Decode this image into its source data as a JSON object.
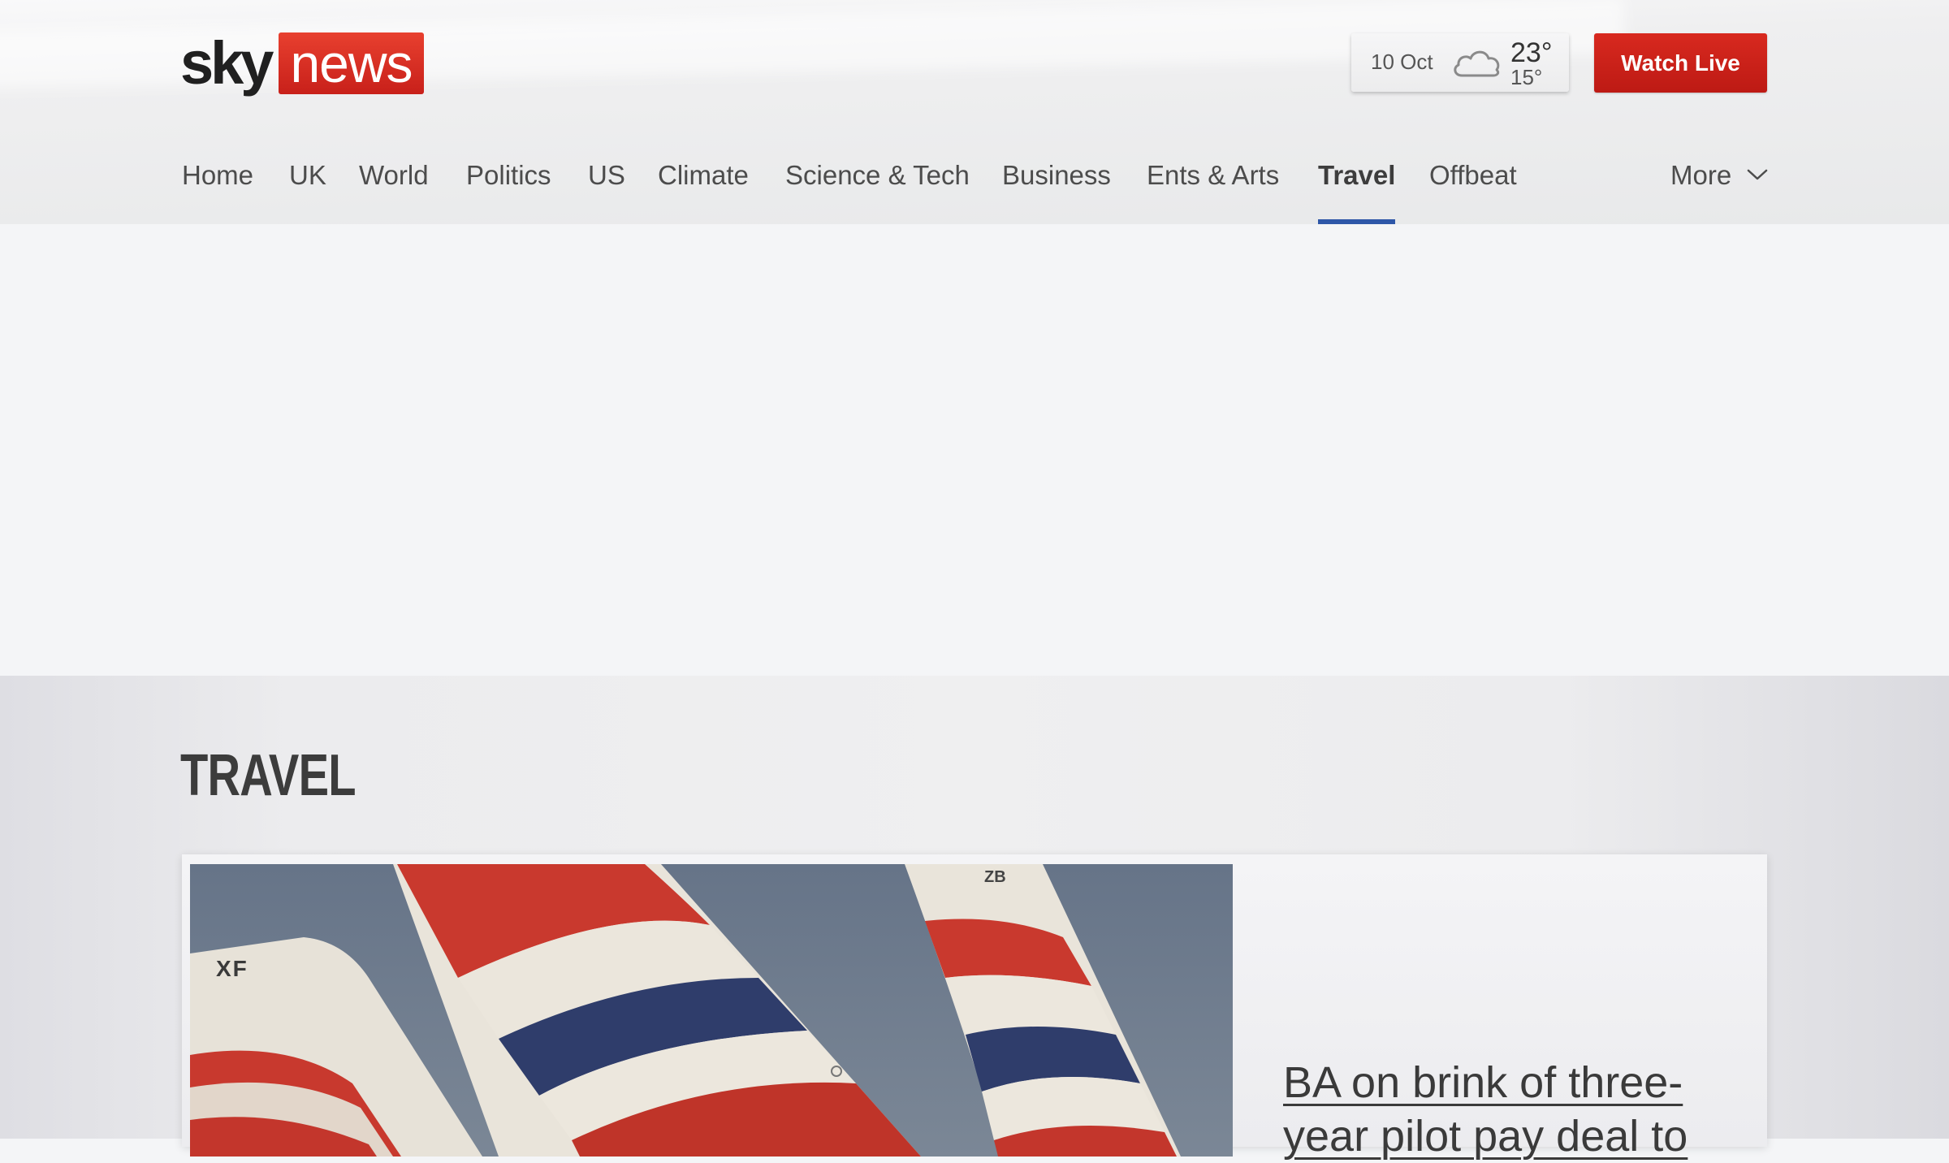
{
  "header": {
    "logo": {
      "sky": "sky",
      "news": "news"
    },
    "weather": {
      "date": "10 Oct",
      "icon": "cloud-icon",
      "high": "23°",
      "low": "15°"
    },
    "watch_live_label": "Watch Live"
  },
  "nav": {
    "items": [
      {
        "label": "Home"
      },
      {
        "label": "UK"
      },
      {
        "label": "World"
      },
      {
        "label": "Politics"
      },
      {
        "label": "US"
      },
      {
        "label": "Climate"
      },
      {
        "label": "Science & Tech"
      },
      {
        "label": "Business"
      },
      {
        "label": "Ents & Arts"
      },
      {
        "label": "Travel",
        "active": true
      },
      {
        "label": "Offbeat"
      }
    ],
    "more_label": "More",
    "active_color": "#2e57a8"
  },
  "section": {
    "title": "TRAVEL"
  },
  "lead_story": {
    "headline": "BA on brink of three-year pilot pay deal to"
  },
  "colors": {
    "brand_red": "#c8201a",
    "accent_blue": "#2e57a8"
  }
}
